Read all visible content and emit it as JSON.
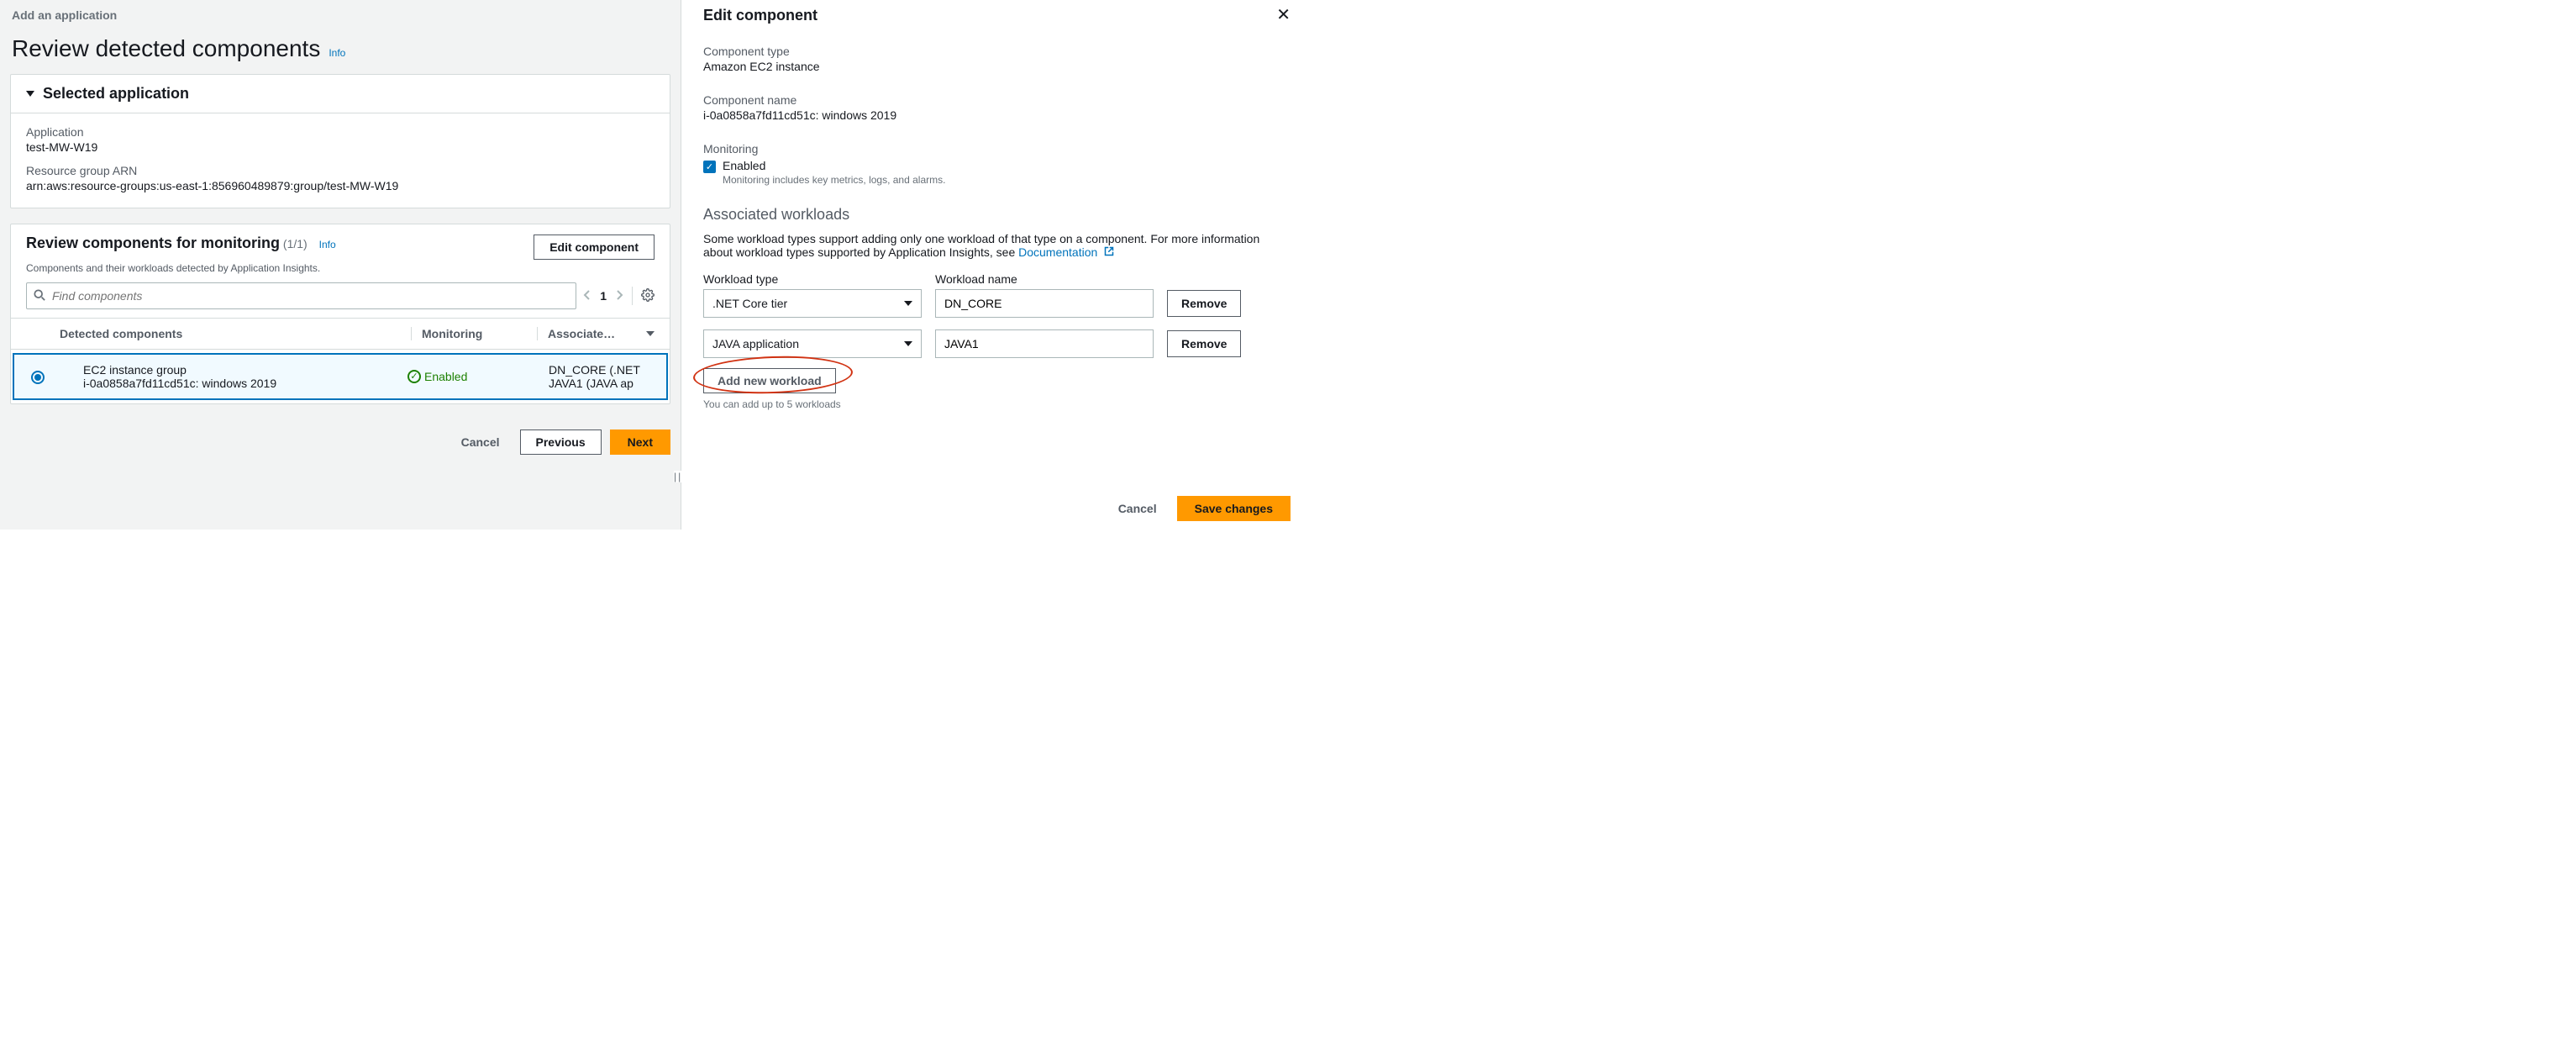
{
  "left": {
    "breadcrumb": "Add an application",
    "page_title": "Review detected components",
    "info_label": "Info",
    "selected_app": {
      "header": "Selected application",
      "app_label": "Application",
      "app_value": "test-MW-W19",
      "arn_label": "Resource group ARN",
      "arn_value": "arn:aws:resource-groups:us-east-1:856960489879:group/test-MW-W19"
    },
    "review": {
      "title": "Review components for monitoring",
      "count": "(1/1)",
      "info_label": "Info",
      "subtitle": "Components and their workloads detected by Application Insights.",
      "edit_button": "Edit component",
      "search_placeholder": "Find components",
      "pager_page": "1",
      "headers": {
        "detected": "Detected components",
        "monitoring": "Monitoring",
        "associated": "Associate…"
      },
      "row": {
        "name": "EC2 instance group",
        "sub": "i-0a0858a7fd11cd51c: windows 2019",
        "monitoring": "Enabled",
        "assoc": [
          "DN_CORE (.NET",
          "JAVA1 (JAVA ap"
        ]
      }
    },
    "actions": {
      "cancel": "Cancel",
      "previous": "Previous",
      "next": "Next"
    }
  },
  "right": {
    "title": "Edit component",
    "comp_type_label": "Component type",
    "comp_type_value": "Amazon EC2 instance",
    "comp_name_label": "Component name",
    "comp_name_value": "i-0a0858a7fd11cd51c: windows 2019",
    "monitoring_label": "Monitoring",
    "monitoring_enabled": "Enabled",
    "monitoring_sub": "Monitoring includes key metrics, logs, and alarms.",
    "assoc_heading": "Associated workloads",
    "assoc_desc_pre": "Some workload types support adding only one workload of that type on a component. For more information about workload types supported by Application Insights, see ",
    "assoc_desc_link": "Documentation",
    "wl_type_header": "Workload type",
    "wl_name_header": "Workload name",
    "workloads": [
      {
        "type": ".NET Core tier",
        "name": "DN_CORE"
      },
      {
        "type": "JAVA application",
        "name": "JAVA1"
      }
    ],
    "remove_label": "Remove",
    "add_label": "Add new workload",
    "add_hint": "You can add up to 5 workloads",
    "actions": {
      "cancel": "Cancel",
      "save": "Save changes"
    }
  }
}
